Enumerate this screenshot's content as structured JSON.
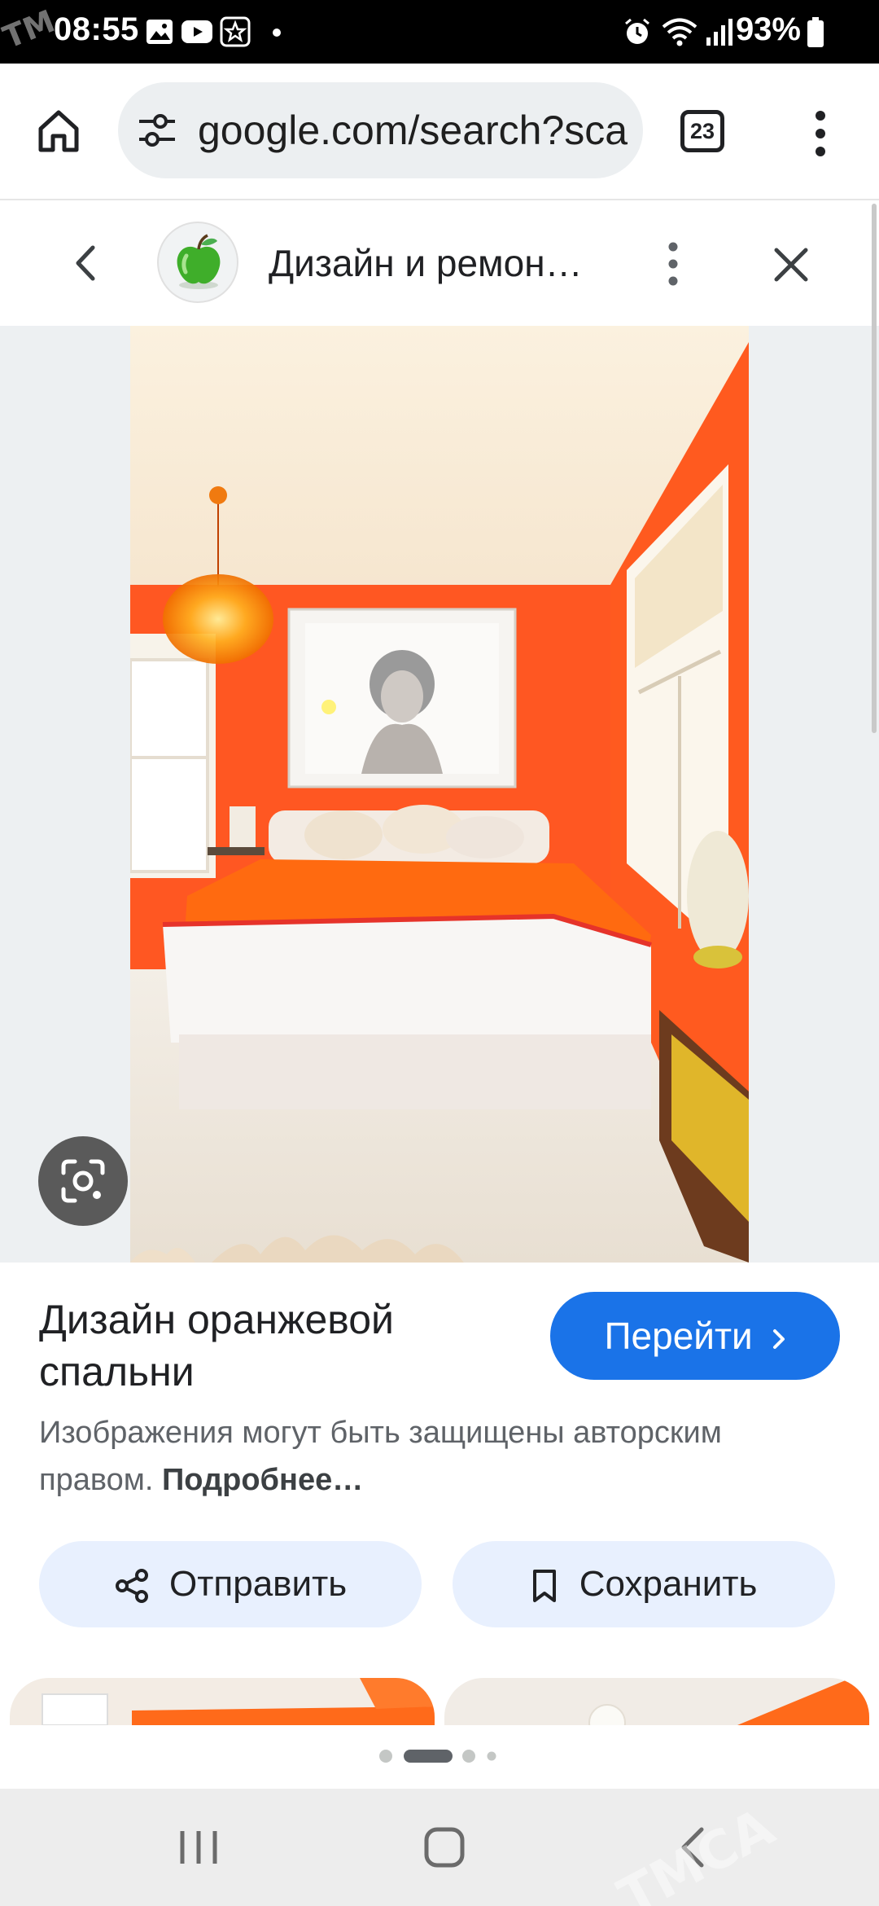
{
  "status_bar": {
    "time": "08:55",
    "battery": "93%",
    "left_icons": [
      "gallery-icon",
      "youtube-icon",
      "star-app-icon",
      "dot-icon"
    ],
    "right_icons": [
      "alarm-icon",
      "wifi-icon",
      "signal-icon",
      "battery-icon"
    ]
  },
  "browser": {
    "url": "google.com/search?sca",
    "tabs_count": "23"
  },
  "viewer": {
    "site_title": "Дизайн и ремон…",
    "image_title": "Дизайн оранжевой спальни",
    "visit_label": "Перейти",
    "copyright_text": "Изображения могут быть защищены авторским правом.",
    "more_link": "Подробнее…",
    "share_label": "Отправить",
    "save_label": "Сохранить"
  },
  "colors": {
    "accent": "#1a73e8",
    "chip_bg": "#e8f0fe",
    "wall_orange": "#ff5a24"
  }
}
